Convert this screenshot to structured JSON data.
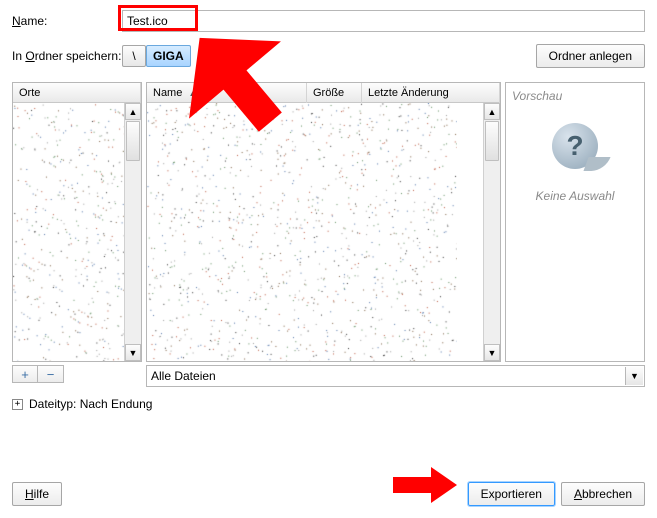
{
  "name_row": {
    "label": "Name:",
    "value": "Test.ico"
  },
  "folder_row": {
    "label_pre": "In ",
    "label_key": "O",
    "label_post": "rdner speichern:",
    "segments": [
      "\\",
      "GIGA"
    ],
    "selected_index": 1,
    "create_btn": "Ordner anlegen"
  },
  "places_panel": {
    "header": "Orte"
  },
  "files_panel": {
    "columns": [
      "Name",
      "Größe",
      "Letzte Änderung"
    ],
    "sort_col_index": 0
  },
  "preview_panel": {
    "title": "Vorschau",
    "empty_msg": "Keine Auswahl"
  },
  "filter": {
    "selected": "Alle Dateien"
  },
  "expander": {
    "label": "Dateityp: Nach Endung",
    "expanded": false
  },
  "buttons": {
    "help": "Hilfe",
    "export": "Exportieren",
    "cancel": "Abbrechen"
  },
  "add_remove": {
    "add": "+",
    "remove": "−"
  }
}
